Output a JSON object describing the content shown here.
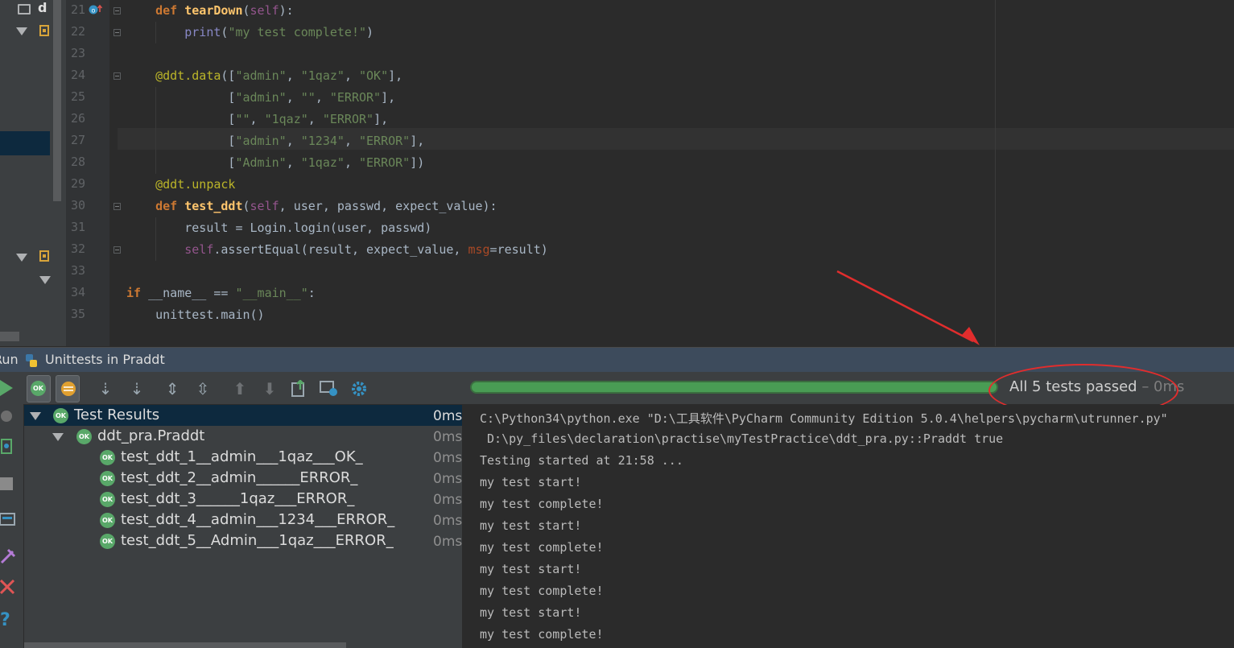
{
  "project": {
    "partial_label": "d"
  },
  "editor": {
    "line_numbers": [
      "21",
      "22",
      "23",
      "24",
      "25",
      "26",
      "27",
      "28",
      "29",
      "30",
      "31",
      "32",
      "33",
      "34",
      "35"
    ]
  },
  "run": {
    "tab_label": "Run",
    "config_name": "Unittests in Praddt",
    "status_main": "All 5 tests passed",
    "status_time": " – 0ms",
    "progress_fraction": 1.0
  },
  "tree": {
    "root": {
      "label": "Test Results",
      "time": "0ms"
    },
    "suite": {
      "label": "ddt_pra.Praddt",
      "time": "0ms"
    },
    "tests": [
      {
        "label": "test_ddt_1__admin___1qaz___OK_",
        "time": "0ms"
      },
      {
        "label": "test_ddt_2__admin______ERROR_",
        "time": "0ms"
      },
      {
        "label": "test_ddt_3______1qaz___ERROR_",
        "time": "0ms"
      },
      {
        "label": "test_ddt_4__admin___1234___ERROR_",
        "time": "0ms"
      },
      {
        "label": "test_ddt_5__Admin___1qaz___ERROR_",
        "time": "0ms"
      }
    ],
    "ok_badge": "OK"
  },
  "console": {
    "lines": [
      "C:\\Python34\\python.exe \"D:\\工具软件\\PyCharm Community Edition 5.0.4\\helpers\\pycharm\\utrunner.py\"",
      " D:\\py_files\\declaration\\practise\\myTestPractice\\ddt_pra.py::Praddt true",
      "Testing started at 21:58 ...",
      "my test start!",
      "my test complete!",
      "my test start!",
      "my test complete!",
      "my test start!",
      "my test complete!",
      "my test start!",
      "my test complete!"
    ]
  },
  "colors": {
    "accent": "#59a869",
    "annotation": "#e12d2d",
    "selection": "#0d293e"
  }
}
